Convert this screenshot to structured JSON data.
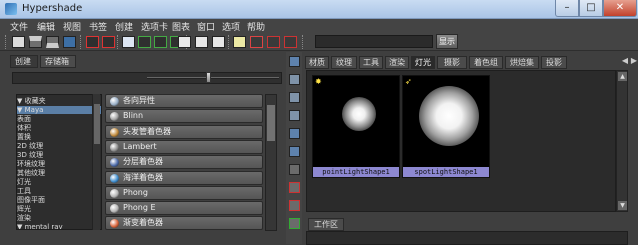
{
  "window": {
    "title": "Hypershade",
    "controls": {
      "minimize": "–",
      "maximize": "□",
      "close": "✕"
    }
  },
  "menu": [
    "文件",
    "编辑",
    "视图",
    "书签",
    "创建",
    "选项卡",
    "图表",
    "窗口",
    "选项",
    "帮助"
  ],
  "toolbar": {
    "search_value": "",
    "show_button": "显示"
  },
  "left_panel": {
    "tabs": [
      "创建",
      "存储箱"
    ],
    "tree": [
      {
        "label": "▼ 收藏夹",
        "selected": false
      },
      {
        "label": "▼ Maya",
        "selected": true
      },
      {
        "label": "   表面",
        "selected": false
      },
      {
        "label": "   体积",
        "selected": false
      },
      {
        "label": "   置换",
        "selected": false
      },
      {
        "label": "   2D 纹理",
        "selected": false
      },
      {
        "label": "   3D 纹理",
        "selected": false
      },
      {
        "label": "   环境纹理",
        "selected": false
      },
      {
        "label": "   其他纹理",
        "selected": false
      },
      {
        "label": "   灯光",
        "selected": false
      },
      {
        "label": "   工具",
        "selected": false
      },
      {
        "label": "   图像平面",
        "selected": false
      },
      {
        "label": "   辉光",
        "selected": false
      },
      {
        "label": "   渲染",
        "selected": false
      },
      {
        "label": "▼ mental ray",
        "selected": false
      }
    ],
    "nodes": [
      {
        "label": "各向异性",
        "color": "#9ab0c8"
      },
      {
        "label": "Blinn",
        "color": "#a3a3a3"
      },
      {
        "label": "头发管着色器",
        "color": "#c08a3c"
      },
      {
        "label": "Lambert",
        "color": "#8d8d8d"
      },
      {
        "label": "分层着色器",
        "color": "#4b6aa9"
      },
      {
        "label": "海洋着色器",
        "color": "#3f8ecf"
      },
      {
        "label": "Phong",
        "color": "#b5b5b5"
      },
      {
        "label": "Phong E",
        "color": "#b5b5b5"
      },
      {
        "label": "渐变着色器",
        "color": "#d9643a"
      }
    ]
  },
  "right_panel": {
    "tabs": [
      "材质",
      "纹理",
      "工具",
      "渲染",
      "灯光",
      "摄影机",
      "着色组",
      "烘焙集",
      "投影"
    ],
    "active_tab": "灯光",
    "swatches": [
      {
        "label": "pointLightShape1",
        "icon": "point-light-icon"
      },
      {
        "label": "spotLightShape1",
        "icon": "spot-light-icon"
      }
    ],
    "bottom_tab": "工作区"
  }
}
